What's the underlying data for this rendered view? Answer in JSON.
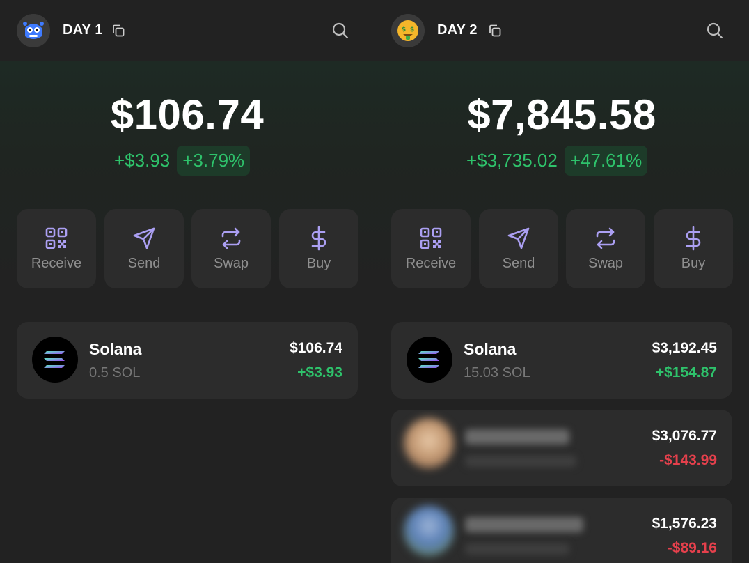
{
  "panels": [
    {
      "wallet_name": "DAY 1",
      "balance": "$106.74",
      "change_amount": "+$3.93",
      "change_percent": "+3.79%",
      "actions": [
        {
          "label": "Receive",
          "icon": "qr-code-icon"
        },
        {
          "label": "Send",
          "icon": "send-icon"
        },
        {
          "label": "Swap",
          "icon": "swap-icon"
        },
        {
          "label": "Buy",
          "icon": "dollar-icon"
        }
      ],
      "tokens": [
        {
          "name": "Solana",
          "amount": "0.5 SOL",
          "value": "$106.74",
          "change": "+$3.93",
          "direction": "up"
        }
      ]
    },
    {
      "wallet_name": "DAY 2",
      "balance": "$7,845.58",
      "change_amount": "+$3,735.02",
      "change_percent": "+47.61%",
      "actions": [
        {
          "label": "Receive",
          "icon": "qr-code-icon"
        },
        {
          "label": "Send",
          "icon": "send-icon"
        },
        {
          "label": "Swap",
          "icon": "swap-icon"
        },
        {
          "label": "Buy",
          "icon": "dollar-icon"
        }
      ],
      "tokens": [
        {
          "name": "Solana",
          "amount": "15.03 SOL",
          "value": "$3,192.45",
          "change": "+$154.87",
          "direction": "up"
        },
        {
          "name": "",
          "amount": "",
          "value": "$3,076.77",
          "change": "-$143.99",
          "direction": "down",
          "blurred": true
        },
        {
          "name": "",
          "amount": "",
          "value": "$1,576.23",
          "change": "-$89.16",
          "direction": "down",
          "blurred": true
        }
      ]
    }
  ],
  "colors": {
    "positive": "#2ec26b",
    "negative": "#e5404c",
    "accent": "#ab9ff2",
    "card": "#2c2c2c"
  }
}
